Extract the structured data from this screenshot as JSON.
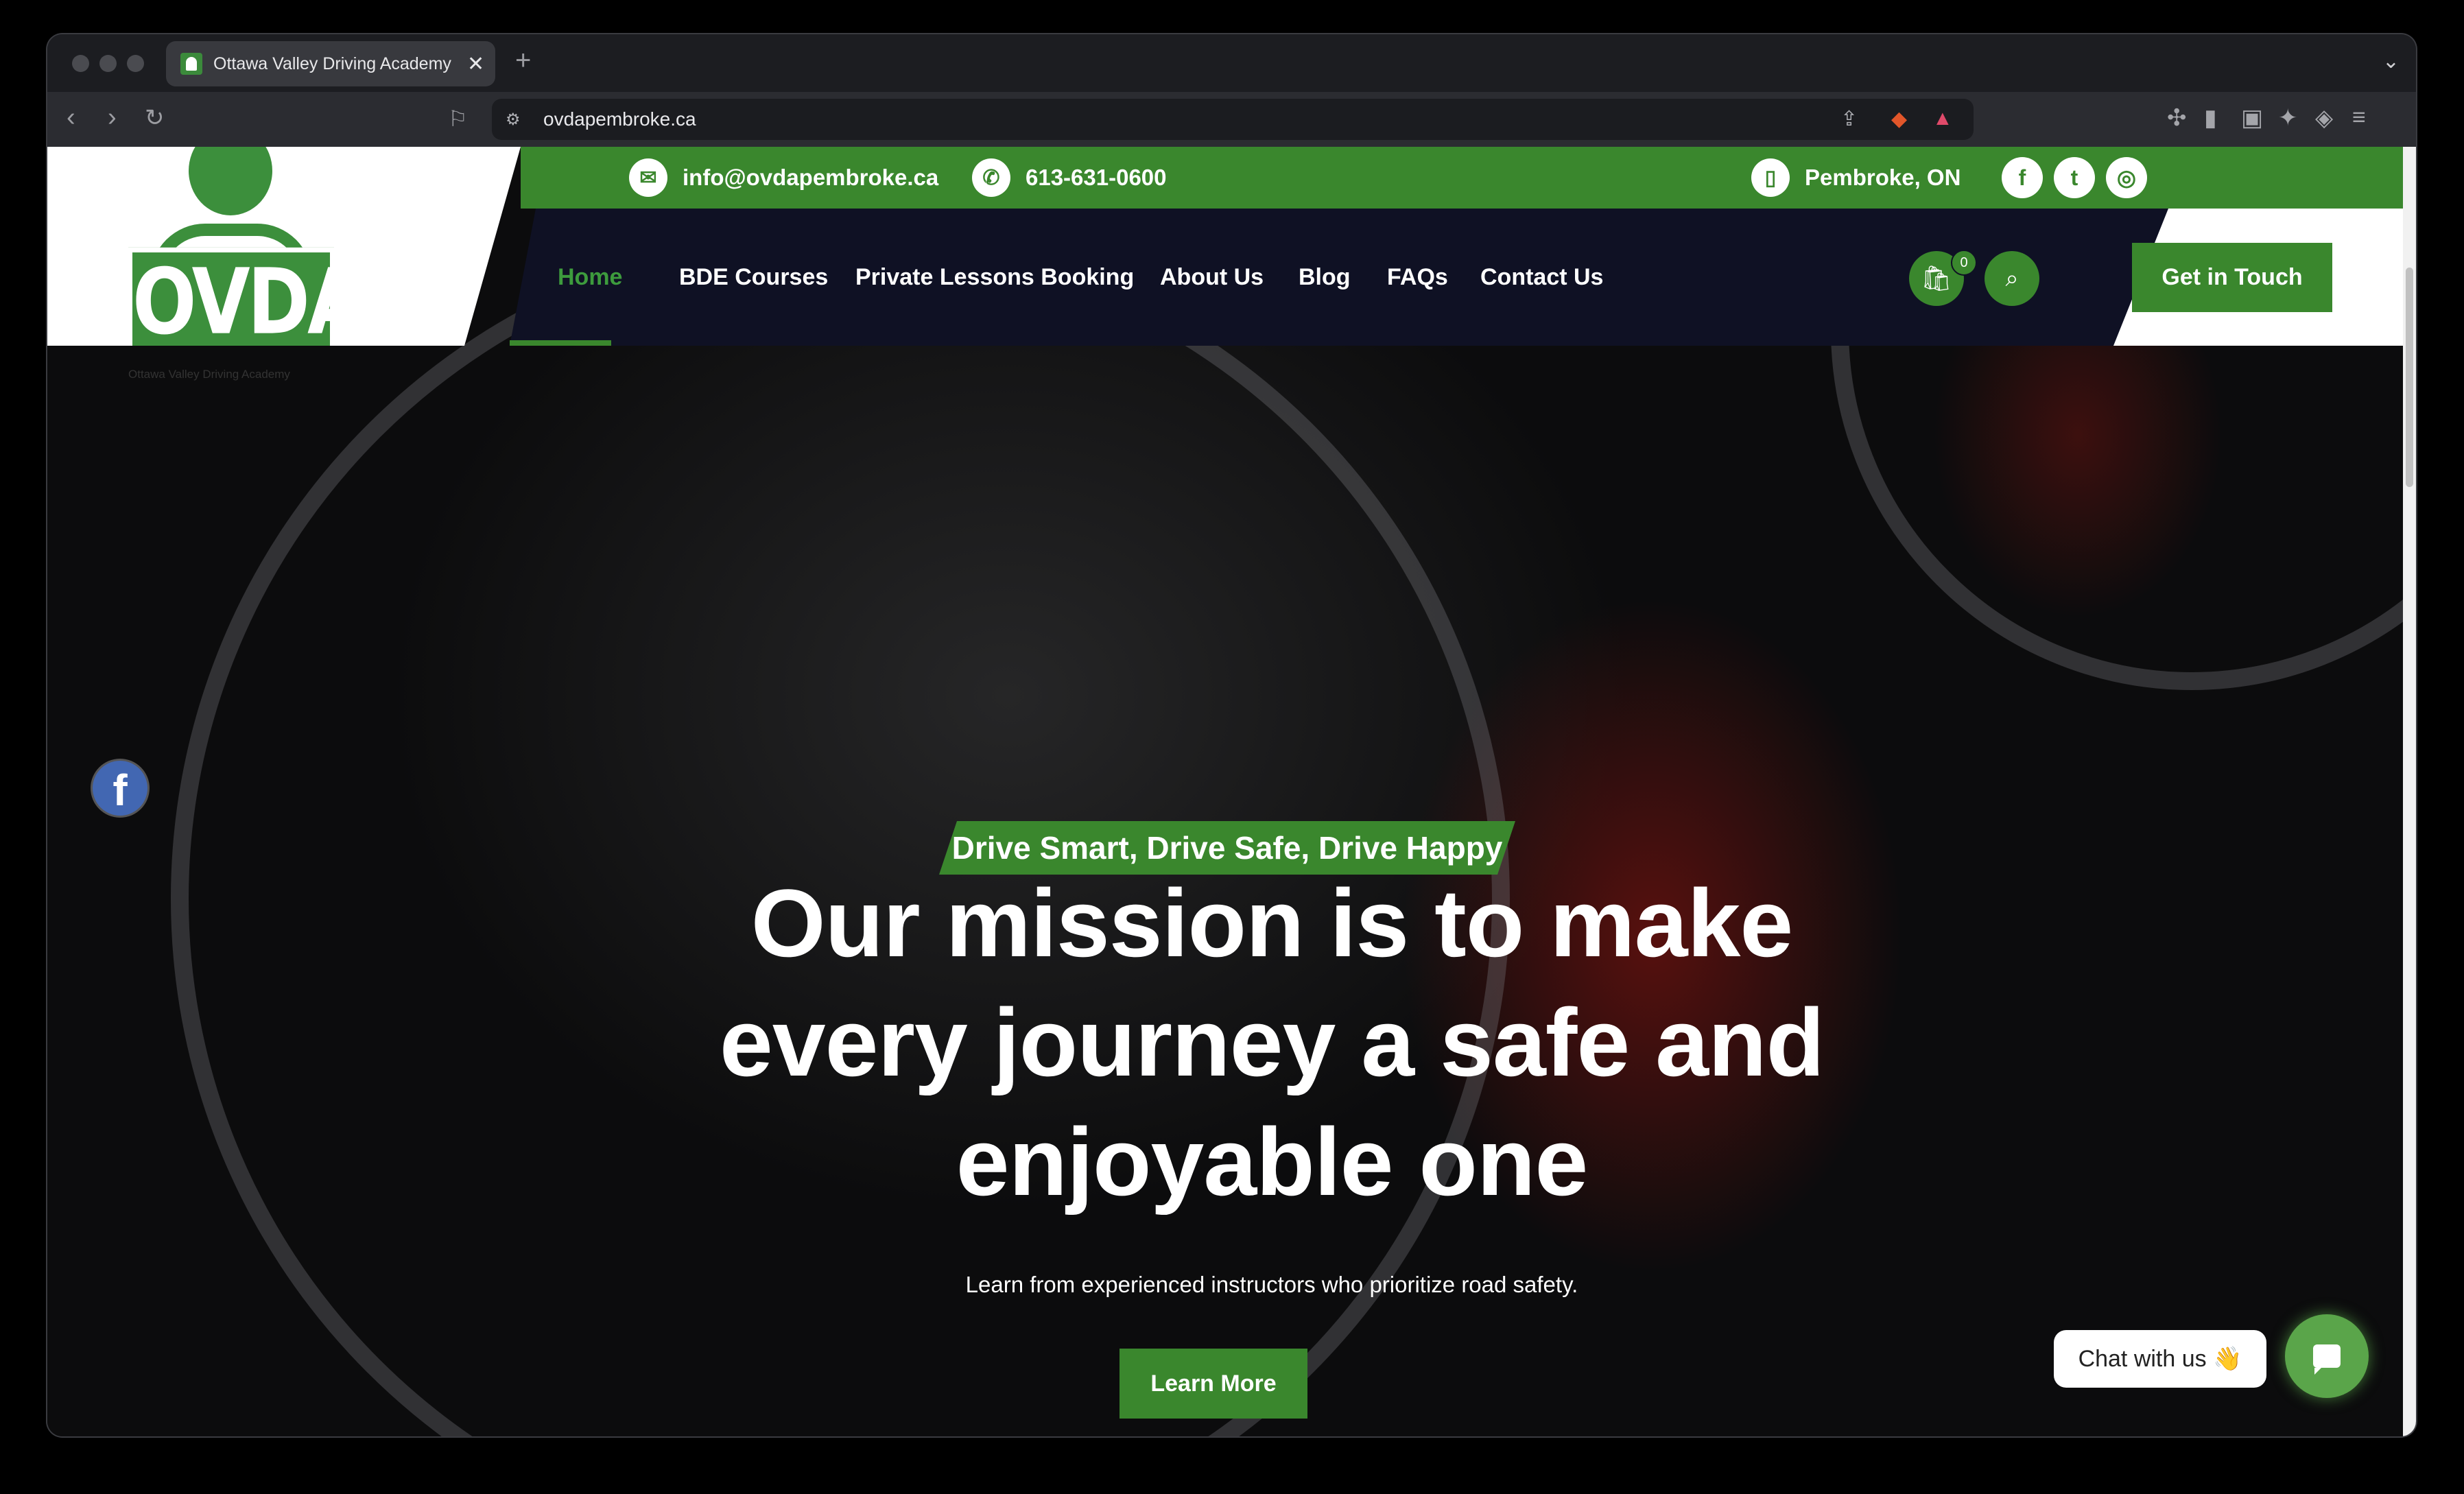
{
  "browser": {
    "tab_title": "Ottawa Valley Driving Academy",
    "tab_close": "✕",
    "new_tab": "+",
    "url": "ovdapembroke.ca"
  },
  "logo": {
    "text": "OVDA",
    "caption": "Ottawa Valley Driving Academy"
  },
  "topbar": {
    "email": "info@ovdapembroke.ca",
    "phone": "613-631-0600",
    "location": "Pembroke, ON",
    "social": [
      "f",
      "t",
      "◎"
    ]
  },
  "nav": {
    "items": [
      "Home",
      "BDE Courses",
      "Private Lessons Booking",
      "About Us",
      "Blog",
      "FAQs",
      "Contact Us"
    ],
    "active": "Home",
    "cart_count": "0",
    "cta": "Get in Touch"
  },
  "hero": {
    "tagline": "Drive Smart, Drive Safe, Drive Happy",
    "headline": "Our mission is to make every journey a safe and enjoyable one",
    "subtext": "Learn from experienced instructors who prioritize road safety.",
    "button": "Learn More"
  },
  "chat": {
    "label": "Chat with us 👋"
  },
  "colors": {
    "brand_green": "#3a872d",
    "nav_dark": "#0f1124"
  }
}
